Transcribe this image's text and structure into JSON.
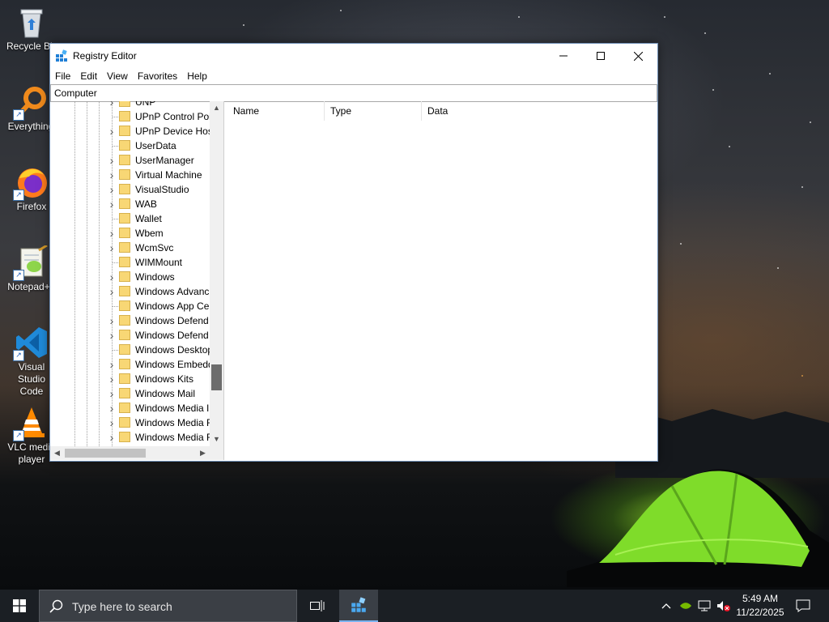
{
  "desktop": {
    "icons": [
      {
        "label": "Recycle Bin",
        "icon": "recycle-bin-icon"
      },
      {
        "label": "Everything",
        "icon": "everything-search-icon"
      },
      {
        "label": "Firefox",
        "icon": "firefox-icon"
      },
      {
        "label": "Notepad++",
        "icon": "notepad-plus-plus-icon"
      },
      {
        "label": "Visual Studio Code",
        "icon": "vscode-icon"
      },
      {
        "label": "VLC media player",
        "icon": "vlc-icon"
      }
    ]
  },
  "window": {
    "title": "Registry Editor",
    "menu": [
      "File",
      "Edit",
      "View",
      "Favorites",
      "Help"
    ],
    "address": "Computer",
    "tree_items": [
      {
        "label": "UNP",
        "expandable": true
      },
      {
        "label": "UPnP Control Poi",
        "expandable": false
      },
      {
        "label": "UPnP Device Hos",
        "expandable": true
      },
      {
        "label": "UserData",
        "expandable": false
      },
      {
        "label": "UserManager",
        "expandable": true
      },
      {
        "label": "Virtual Machine",
        "expandable": true
      },
      {
        "label": "VisualStudio",
        "expandable": true
      },
      {
        "label": "WAB",
        "expandable": true
      },
      {
        "label": "Wallet",
        "expandable": false
      },
      {
        "label": "Wbem",
        "expandable": true
      },
      {
        "label": "WcmSvc",
        "expandable": true
      },
      {
        "label": "WIMMount",
        "expandable": false
      },
      {
        "label": "Windows",
        "expandable": true
      },
      {
        "label": "Windows Advanc",
        "expandable": true
      },
      {
        "label": "Windows App Ce",
        "expandable": false
      },
      {
        "label": "Windows Defend",
        "expandable": true
      },
      {
        "label": "Windows Defend",
        "expandable": true
      },
      {
        "label": "Windows Desktop",
        "expandable": false
      },
      {
        "label": "Windows Embedd",
        "expandable": true
      },
      {
        "label": "Windows Kits",
        "expandable": true
      },
      {
        "label": "Windows Mail",
        "expandable": true
      },
      {
        "label": "Windows Media I",
        "expandable": true
      },
      {
        "label": "Windows Media F",
        "expandable": true
      },
      {
        "label": "Windows Media F",
        "expandable": true
      }
    ],
    "columns": [
      "Name",
      "Type",
      "Data"
    ]
  },
  "taskbar": {
    "search_placeholder": "Type here to search",
    "time": "5:49 AM",
    "date": "11/22/2025"
  }
}
